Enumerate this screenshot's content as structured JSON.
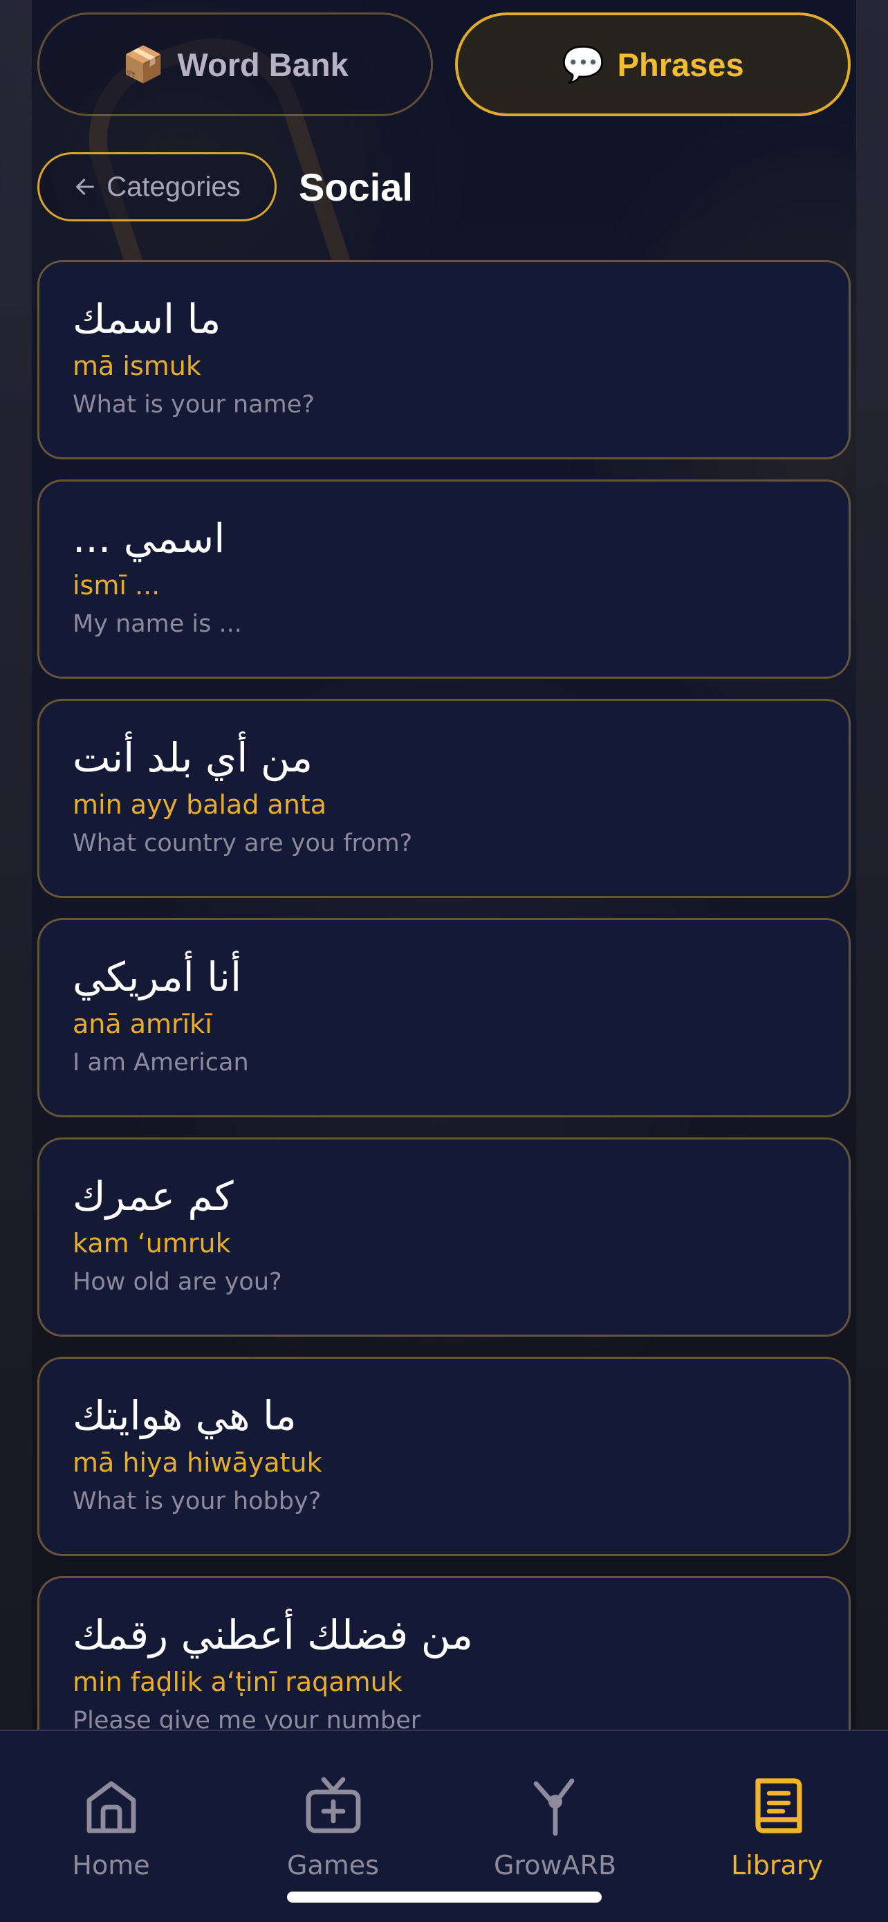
{
  "segments": {
    "word_bank": {
      "emoji": "📦",
      "label": "Word Bank"
    },
    "phrases": {
      "emoji": "💬",
      "label": "Phrases",
      "active": true
    }
  },
  "header": {
    "back_label": "Categories",
    "title": "Social"
  },
  "phrases": [
    {
      "arabic": "ما اسمك",
      "translit": "mā ismuk",
      "english": "What is your name?"
    },
    {
      "arabic": "اسمي ...",
      "translit": "ismī ...",
      "english": "My name is ..."
    },
    {
      "arabic": "من أي بلد أنت",
      "translit": "min ayy balad anta",
      "english": "What country are you from?"
    },
    {
      "arabic": "أنا أمريكي",
      "translit": "anā amrīkī",
      "english": "I am American"
    },
    {
      "arabic": "كم عمرك",
      "translit": "kam ‘umruk",
      "english": "How old are you?"
    },
    {
      "arabic": "ما هي هوايتك",
      "translit": "mā hiya hiwāyatuk",
      "english": "What is your hobby?"
    },
    {
      "arabic": "من فضلك أعطني رقمك",
      "translit": "min faḍlik a‘ṭinī raqamuk",
      "english": "Please give me your number"
    }
  ],
  "tabs": [
    {
      "label": "Home",
      "icon": "home-icon",
      "active": false
    },
    {
      "label": "Games",
      "icon": "tv-plus-icon",
      "active": false
    },
    {
      "label": "GrowARB",
      "icon": "sprout-icon",
      "active": false
    },
    {
      "label": "Library",
      "icon": "book-icon",
      "active": true
    }
  ],
  "colors": {
    "accent": "#F0B52A",
    "card_bg": "#141A36",
    "inactive_text": "#8E8B9C"
  }
}
